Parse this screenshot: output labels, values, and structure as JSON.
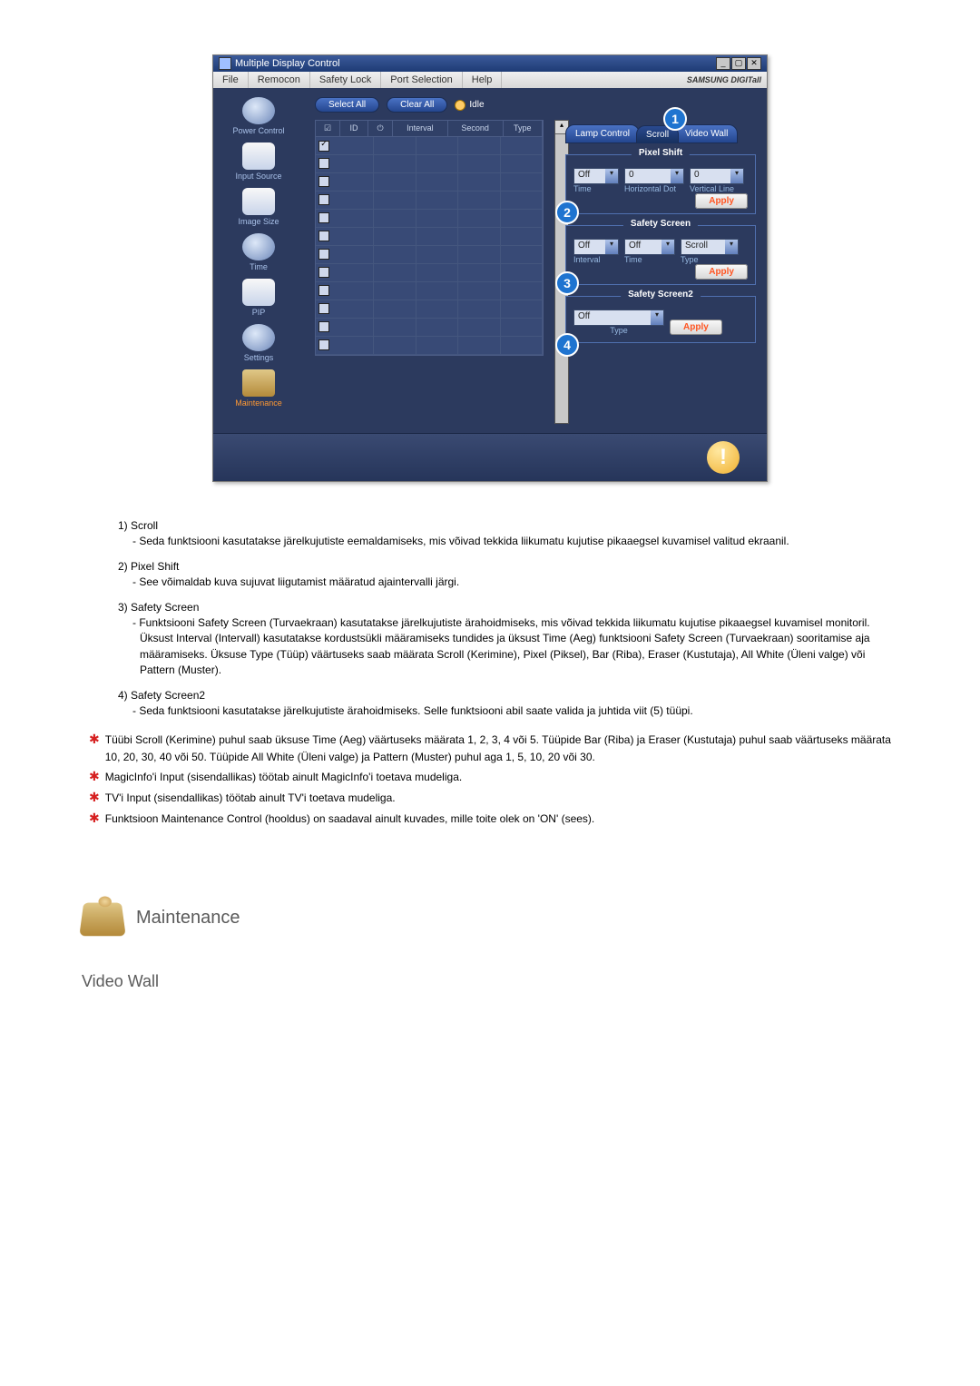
{
  "app": {
    "title": "Multiple Display Control",
    "brand": "SAMSUNG DIGITall"
  },
  "menubar": [
    "File",
    "Remocon",
    "Safety Lock",
    "Port Selection",
    "Help"
  ],
  "sidebar": [
    {
      "label": "Power Control"
    },
    {
      "label": "Input Source"
    },
    {
      "label": "Image Size"
    },
    {
      "label": "Time"
    },
    {
      "label": "PIP"
    },
    {
      "label": "Settings"
    },
    {
      "label": "Maintenance"
    }
  ],
  "topButtons": {
    "selectAll": "Select All",
    "clearAll": "Clear All",
    "idle": "Idle"
  },
  "grid": {
    "headers": {
      "id": "ID",
      "interval": "Interval",
      "second": "Second",
      "type": "Type"
    }
  },
  "tabs": {
    "lamp": "Lamp Control",
    "scroll": "Scroll",
    "video": "Video Wall"
  },
  "pixelShift": {
    "legend": "Pixel Shift",
    "timeLabel": "Time",
    "hdotLabel": "Horizontal Dot",
    "vlineLabel": "Vertical Line",
    "timeVal": "Off",
    "hdotVal": "0",
    "vlineVal": "0",
    "apply": "Apply"
  },
  "safetyScreen": {
    "legend": "Safety Screen",
    "intervalLabel": "Interval",
    "timeLabel": "Time",
    "typeLabel": "Type",
    "intervalVal": "Off",
    "timeVal": "Off",
    "typeVal": "Scroll",
    "apply": "Apply"
  },
  "safetyScreen2": {
    "legend": "Safety Screen2",
    "typeLabel": "Type",
    "typeVal": "Off",
    "apply": "Apply"
  },
  "callouts": {
    "c1": "1",
    "c2": "2",
    "c3": "3",
    "c4": "4"
  },
  "doc": {
    "items": [
      {
        "title": "1)  Scroll",
        "sub": "- Seda funktsiooni kasutatakse järelkujutiste eemaldamiseks, mis võivad tekkida liikumatu kujutise pikaaegsel kuvamisel valitud ekraanil."
      },
      {
        "title": "2)  Pixel Shift",
        "sub": "- See võimaldab kuva sujuvat liigutamist määratud ajaintervalli järgi."
      },
      {
        "title": "3)  Safety Screen",
        "sub": "- Funktsiooni Safety Screen (Turvaekraan) kasutatakse järelkujutiste ärahoidmiseks, mis võivad tekkida liikumatu kujutise pikaaegsel kuvamisel monitoril.  Üksust Interval (Intervall) kasutatakse kordustsükli määramiseks tundides ja üksust Time (Aeg) funktsiooni Safety Screen (Turvaekraan) sooritamise aja määramiseks. Üksuse Type (Tüüp) väärtuseks saab määrata Scroll (Kerimine), Pixel (Piksel), Bar (Riba), Eraser (Kustutaja), All White (Üleni valge) või Pattern (Muster)."
      },
      {
        "title": "4)  Safety Screen2",
        "sub": "- Seda funktsiooni kasutatakse järelkujutiste ärahoidmiseks. Selle funktsiooni abil saate valida ja juhtida viit (5) tüüpi."
      }
    ],
    "notes": [
      "Tüübi Scroll (Kerimine) puhul saab üksuse Time (Aeg) väärtuseks määrata 1, 2, 3, 4 või 5. Tüüpide Bar (Riba) ja Eraser (Kustutaja) puhul saab väärtuseks määrata 10, 20, 30, 40 või 50. Tüüpide All White (Üleni valge) ja Pattern (Muster) puhul aga 1, 5, 10, 20 või 30.",
      "MagicInfo'i Input (sisendallikas) töötab ainult MagicInfo'i toetava mudeliga.",
      "TV'i Input (sisendallikas) töötab ainult TV'i toetava mudeliga.",
      "Funktsioon Maintenance Control (hooldus) on saadaval ainult kuvades, mille toite olek on 'ON' (sees)."
    ]
  },
  "section": {
    "maintenance": "Maintenance",
    "videoWall": "Video Wall"
  }
}
